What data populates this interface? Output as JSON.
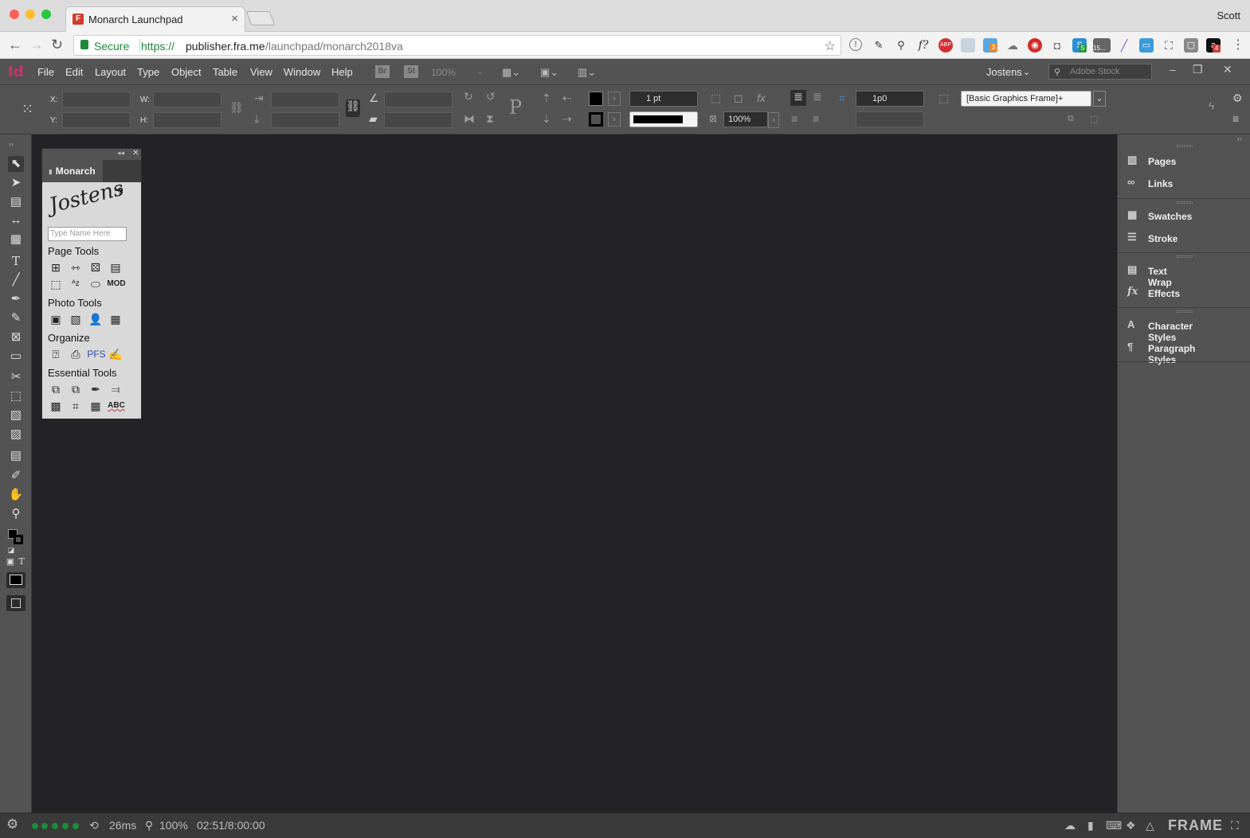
{
  "browser": {
    "tab_title": "Monarch Launchpad",
    "tab_close": "×",
    "user_name": "Scott",
    "secure_label": "Secure",
    "url_protocol": "https://",
    "url_host": "publisher.fra.me",
    "url_path": "/launchpad/monarch2018va",
    "extension_badges": {
      "ext3": "3",
      "ext5": "5",
      "ext15": "15...",
      "ext4": "4"
    }
  },
  "indesign": {
    "menu": [
      "File",
      "Edit",
      "Layout",
      "Type",
      "Object",
      "Table",
      "View",
      "Window",
      "Help"
    ],
    "bridge_label": "Br",
    "stock_label": "St",
    "zoom": "100%",
    "workspace": "Jostens",
    "stock_search_placeholder": "Adobe Stock",
    "control": {
      "x_label": "X:",
      "y_label": "Y:",
      "w_label": "W:",
      "h_label": "H:",
      "stroke_weight": "1 pt",
      "opacity": "100%",
      "gutter": "1p0",
      "object_style": "[Basic Graphics Frame]+"
    }
  },
  "monarch_panel": {
    "tab_label": "Monarch",
    "logo_text": "Jostens",
    "help": "?",
    "name_placeholder": "Type Name Here",
    "sections": [
      "Page Tools",
      "Photo Tools",
      "Organize",
      "Essential Tools"
    ],
    "mod_label": "MOD",
    "pfs_label": "PFS",
    "abc_label": "ABC"
  },
  "right_panels": [
    {
      "label": "Pages",
      "icon": "pages-icon"
    },
    {
      "label": "Links",
      "icon": "links-icon"
    },
    {
      "label": "Swatches",
      "icon": "swatches-icon"
    },
    {
      "label": "Stroke",
      "icon": "stroke-icon"
    },
    {
      "label": "Text Wrap",
      "icon": "text-wrap-icon"
    },
    {
      "label": "Effects",
      "icon": "effects-icon"
    },
    {
      "label": "Character Styles",
      "icon": "character-styles-icon"
    },
    {
      "label": "Paragraph Styles",
      "icon": "paragraph-styles-icon"
    }
  ],
  "status": {
    "latency": "26ms",
    "zoom": "100%",
    "session_time": "02:51/8:00:00",
    "brand": "FRAME"
  },
  "colors": {
    "accent_indesign": "#c8336d",
    "secure_green": "#1e8a3a",
    "status_green": "#1f8b3a",
    "pasteboard": "#232226"
  }
}
